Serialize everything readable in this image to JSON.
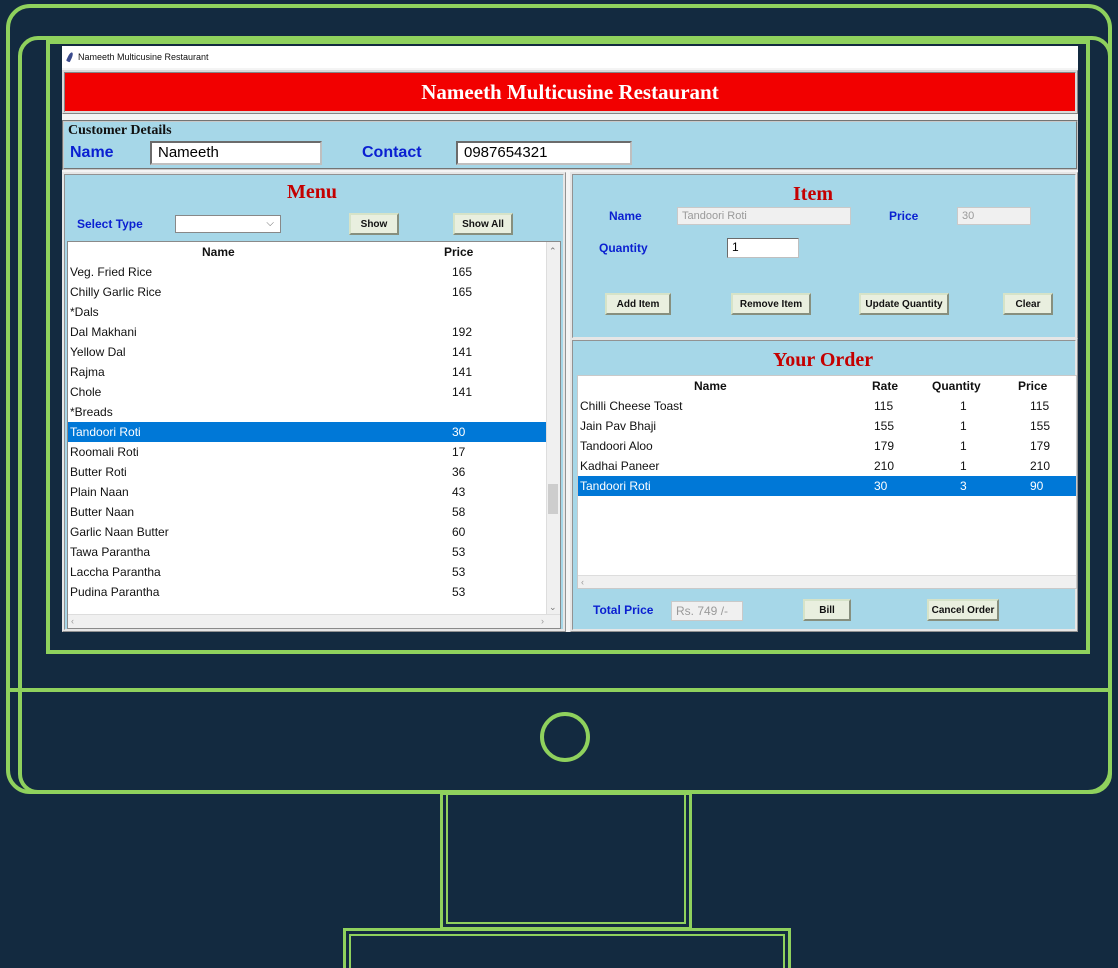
{
  "window": {
    "title": "Nameeth Multicusine Restaurant"
  },
  "banner": {
    "title": "Nameeth Multicusine Restaurant"
  },
  "customer": {
    "section_title": "Customer Details",
    "name_label": "Name",
    "name_value": "Nameeth",
    "contact_label": "Contact",
    "contact_value": "0987654321"
  },
  "menu": {
    "title": "Menu",
    "select_type_label": "Select Type",
    "select_type_value": "",
    "show_button": "Show",
    "show_all_button": "Show All",
    "columns": {
      "name": "Name",
      "price": "Price"
    },
    "rows": [
      {
        "name": "Veg. Fried Rice",
        "price": "165"
      },
      {
        "name": "Chilly Garlic Rice",
        "price": "165"
      },
      {
        "name": "*Dals",
        "price": ""
      },
      {
        "name": "Dal Makhani",
        "price": "192"
      },
      {
        "name": "Yellow Dal",
        "price": "141"
      },
      {
        "name": "Rajma",
        "price": "141"
      },
      {
        "name": "Chole",
        "price": "141"
      },
      {
        "name": "*Breads",
        "price": ""
      },
      {
        "name": "Tandoori Roti",
        "price": "30",
        "selected": true
      },
      {
        "name": "Roomali Roti",
        "price": "17"
      },
      {
        "name": "Butter Roti",
        "price": "36"
      },
      {
        "name": "Plain Naan",
        "price": "43"
      },
      {
        "name": "Butter Naan",
        "price": "58"
      },
      {
        "name": "Garlic Naan Butter",
        "price": "60"
      },
      {
        "name": "Tawa Parantha",
        "price": "53"
      },
      {
        "name": "Laccha Parantha",
        "price": "53"
      },
      {
        "name": "Pudina Parantha",
        "price": "53"
      }
    ]
  },
  "item": {
    "title": "Item",
    "name_label": "Name",
    "name_value": "Tandoori Roti",
    "price_label": "Price",
    "price_value": "30",
    "quantity_label": "Quantity",
    "quantity_value": "1",
    "add_button": "Add Item",
    "remove_button": "Remove Item",
    "update_button": "Update Quantity",
    "clear_button": "Clear"
  },
  "order": {
    "title": "Your Order",
    "columns": {
      "name": "Name",
      "rate": "Rate",
      "quantity": "Quantity",
      "price": "Price"
    },
    "rows": [
      {
        "name": "Chilli Cheese Toast",
        "rate": "115",
        "quantity": "1",
        "price": "115"
      },
      {
        "name": "Jain Pav Bhaji",
        "rate": "155",
        "quantity": "1",
        "price": "155"
      },
      {
        "name": "Tandoori Aloo",
        "rate": "179",
        "quantity": "1",
        "price": "179"
      },
      {
        "name": "Kadhai Paneer",
        "rate": "210",
        "quantity": "1",
        "price": "210"
      },
      {
        "name": "Tandoori Roti",
        "rate": "30",
        "quantity": "3",
        "price": "90",
        "selected": true
      }
    ],
    "total_label": "Total Price",
    "total_value": "Rs. 749 /-",
    "bill_button": "Bill",
    "cancel_button": "Cancel Order"
  },
  "colors": {
    "background": "#132a40",
    "monitor_outline": "#8fd15d",
    "banner_red": "#f20000",
    "panel_blue": "#a6d7e8",
    "label_blue": "#0a1fd1",
    "title_red": "#c40000",
    "selection": "#0078d7"
  }
}
